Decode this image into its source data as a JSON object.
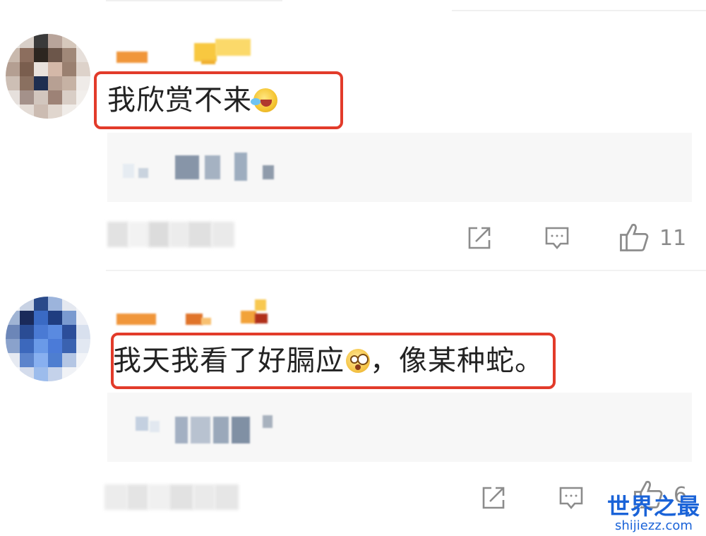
{
  "comments": [
    {
      "text": "我欣赏不来",
      "emoji": "laughing-tears-emoji",
      "like_count": "11"
    },
    {
      "text_before_emoji": "我天我看了好膈应",
      "emoji": "shocked-emoji",
      "text_after_emoji": "，像某种蛇。",
      "like_count": "6"
    }
  ],
  "watermark": {
    "title": "世界之最",
    "url": "shijiezz.com"
  },
  "icons": {
    "share": "share-icon",
    "reply": "comment-icon",
    "like": "thumbs-up-icon"
  },
  "colors": {
    "highlight": "#e23b2a",
    "text": "#222222",
    "muted": "#8a8a8a",
    "watermark": "#1a63d8",
    "panel": "#f7f7f7"
  }
}
